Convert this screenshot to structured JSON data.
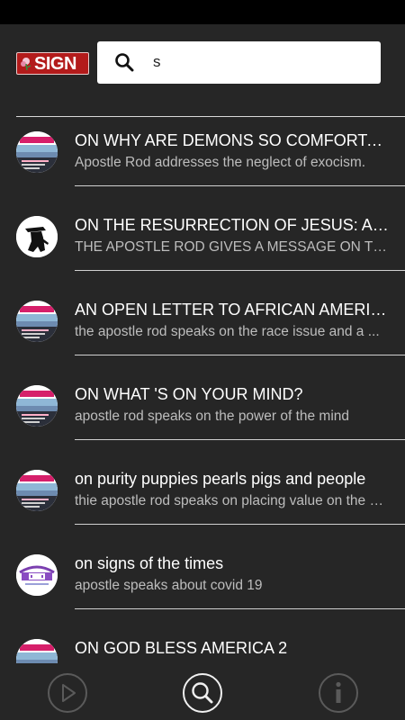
{
  "app": {
    "logo_text": "SIGN"
  },
  "search": {
    "value": "s",
    "icon": "search-icon"
  },
  "results": [
    {
      "title": "ON WHY ARE DEMONS SO COMFORTABLE",
      "subtitle": "Apostle Rod addresses the neglect of exocism.",
      "thumb": "sign-poster"
    },
    {
      "title": "ON THE RESURRECTION OF JESUS: AN APOSTOLIC MESSAGE",
      "subtitle": "THE APOSTLE ROD GIVES A MESSAGE ON THE RESURRECTION",
      "thumb": "silhouette"
    },
    {
      "title": "AN OPEN LETTER TO AFRICAN AMERICANS",
      "subtitle": "the apostle rod speaks on the race issue and a ...",
      "thumb": "sign-poster"
    },
    {
      "title": "ON WHAT 'S ON YOUR MIND?",
      "subtitle": "apostle rod speaks on the power of the mind",
      "thumb": "sign-poster"
    },
    {
      "title": "on purity puppies pearls pigs and people",
      "subtitle": "thie apostle rod speaks on placing value on the people",
      "thumb": "sign-poster"
    },
    {
      "title": "on signs of the times",
      "subtitle": "apostle speaks about covid 19",
      "thumb": "purple-banner"
    },
    {
      "title": "ON GOD BLESS AMERICA 2",
      "subtitle": "",
      "thumb": "sign-poster"
    }
  ],
  "bottom_nav": [
    {
      "name": "play-icon"
    },
    {
      "name": "search-icon"
    },
    {
      "name": "info-icon"
    }
  ],
  "colors": {
    "background": "#262626",
    "status_bar": "#000000",
    "logo_red": "#b31b1b",
    "divider": "#d0d0d0"
  }
}
